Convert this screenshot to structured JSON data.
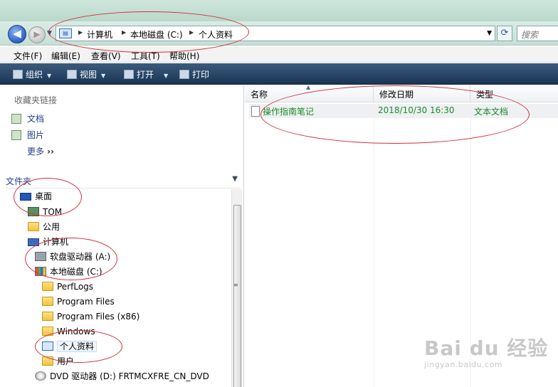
{
  "address_bar": {
    "crumbs": [
      "计算机",
      "本地磁盘 (C:)",
      "个人资料"
    ],
    "search_placeholder": "搜索"
  },
  "menu": [
    "文件(F)",
    "编辑(E)",
    "查看(V)",
    "工具(T)",
    "帮助(H)"
  ],
  "toolbar": {
    "organize": "组织",
    "views": "视图",
    "open": "打开",
    "print": "打印"
  },
  "favorites": {
    "header": "收藏夹链接",
    "items": [
      "文档",
      "图片",
      "更多"
    ]
  },
  "folders": {
    "header": "文件夹",
    "tree": [
      {
        "label": "桌面",
        "icon": "desktop-icon"
      },
      {
        "label": "TOM",
        "icon": "user-icon"
      },
      {
        "label": "公用",
        "icon": "folder-icon"
      },
      {
        "label": "计算机",
        "icon": "computer-icon"
      },
      {
        "label": "软盘驱动器 (A:)",
        "icon": "floppy-icon"
      },
      {
        "label": "本地磁盘 (C:)",
        "icon": "drive-icon"
      },
      {
        "label": "PerfLogs",
        "icon": "folder-icon"
      },
      {
        "label": "Program Files",
        "icon": "folder-icon"
      },
      {
        "label": "Program Files (x86)",
        "icon": "folder-icon"
      },
      {
        "label": "Windows",
        "icon": "folder-icon"
      },
      {
        "label": "个人资料",
        "icon": "personal-folder-icon"
      },
      {
        "label": "用户",
        "icon": "folder-icon"
      },
      {
        "label": "DVD 驱动器 (D:) FRTMCXFRE_CN_DVD",
        "icon": "dvd-icon"
      }
    ]
  },
  "file_list": {
    "columns": [
      "名称",
      "修改日期",
      "类型"
    ],
    "rows": [
      {
        "name": "操作指南笔记",
        "modified": "2018/10/30 16:30",
        "type": "文本文档"
      }
    ]
  },
  "watermark": {
    "main": "Bai du 经验",
    "sub": "jingyan.baidu.com"
  },
  "colors": {
    "annotation": "#d2303a",
    "file_text": "#1c8a2a",
    "toolbar": "#1a3553"
  }
}
